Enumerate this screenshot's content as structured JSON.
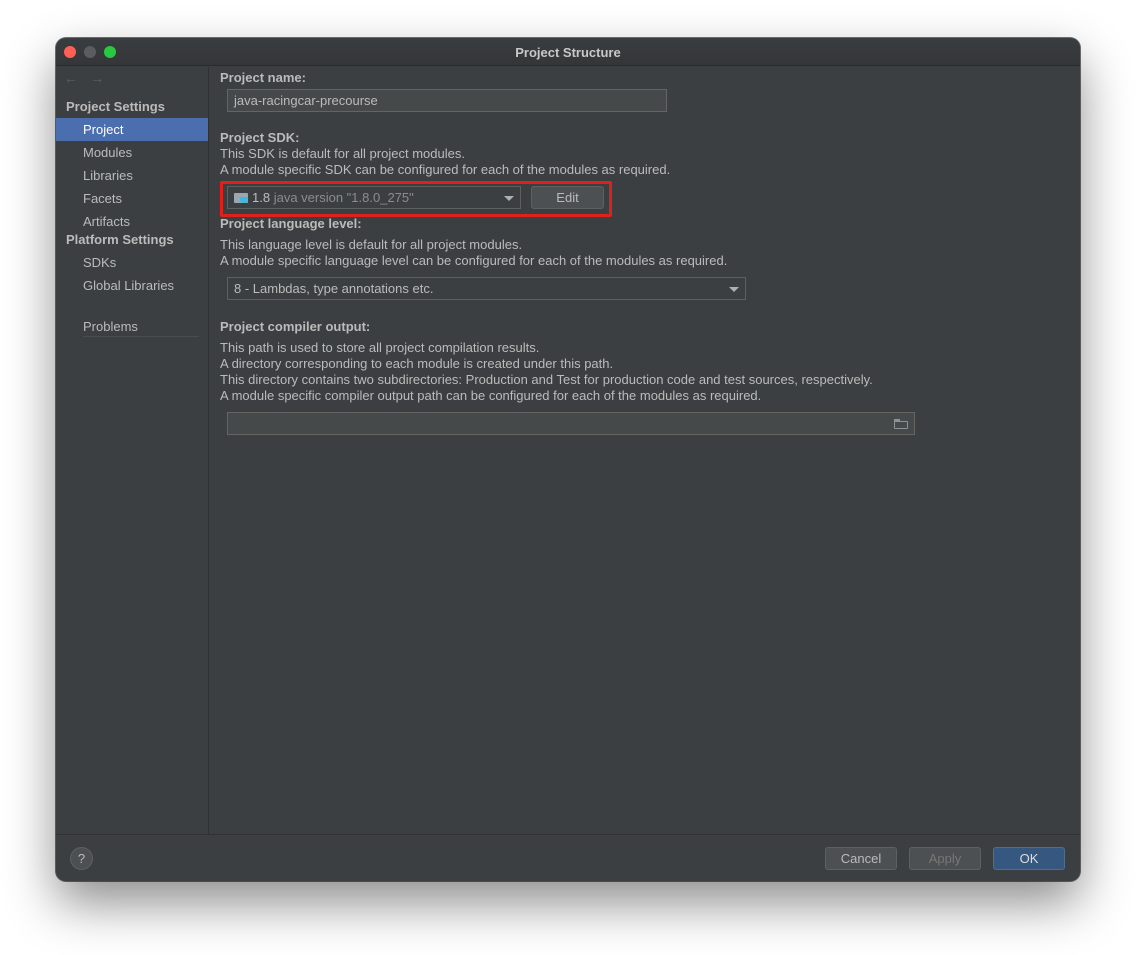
{
  "window": {
    "title": "Project Structure"
  },
  "nav": {
    "back": "←",
    "forward": "→"
  },
  "sidebar": {
    "project_settings_header": "Project Settings",
    "project_items": [
      "Project",
      "Modules",
      "Libraries",
      "Facets",
      "Artifacts"
    ],
    "platform_settings_header": "Platform Settings",
    "platform_items": [
      "SDKs",
      "Global Libraries"
    ],
    "problems": "Problems",
    "selected": "Project"
  },
  "main": {
    "project_name_label": "Project name:",
    "project_name_value": "java-racingcar-precourse",
    "sdk_label": "Project SDK:",
    "sdk_desc1": "This SDK is default for all project modules.",
    "sdk_desc2": "A module specific SDK can be configured for each of the modules as required.",
    "sdk_version": "1.8",
    "sdk_detail": "java version \"1.8.0_275\"",
    "sdk_edit": "Edit",
    "lang_label": "Project language level:",
    "lang_desc1": "This language level is default for all project modules.",
    "lang_desc2": "A module specific language level can be configured for each of the modules as required.",
    "lang_value": "8 - Lambdas, type annotations etc.",
    "compiler_label": "Project compiler output:",
    "compiler_desc1": "This path is used to store all project compilation results.",
    "compiler_desc2": "A directory corresponding to each module is created under this path.",
    "compiler_desc3": "This directory contains two subdirectories: Production and Test for production code and test sources, respectively.",
    "compiler_desc4": "A module specific compiler output path can be configured for each of the modules as required.",
    "compiler_output_value": ""
  },
  "footer": {
    "help": "?",
    "cancel": "Cancel",
    "apply": "Apply",
    "ok": "OK"
  },
  "colors": {
    "background": "#3c3f41",
    "selection": "#4b6eaf",
    "highlight_box": "#e0201a",
    "ok_button": "#365880"
  }
}
